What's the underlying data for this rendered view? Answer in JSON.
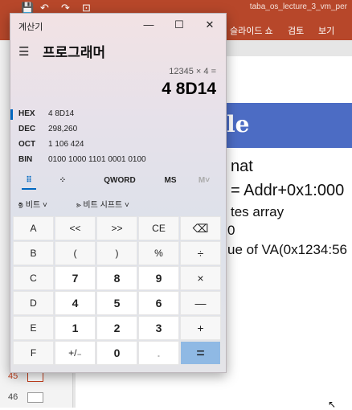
{
  "ppt": {
    "title": "taba_os_lecture_3_vm_per",
    "quick_access": [
      "💾",
      "↶",
      "↷",
      "⊡"
    ],
    "ribbon_tabs": [
      "슬라이드 쇼",
      "검토",
      "보기"
    ],
    "slides": [
      {
        "num": "45"
      },
      {
        "num": "46"
      }
    ],
    "slide": {
      "title_fragment": "le",
      "lines": [
        "nat",
        "= Addr+0x1:000",
        "tes array",
        "0",
        "ue of VA(0x1234:56"
      ]
    }
  },
  "calculator": {
    "window_title": "계산기",
    "window_buttons": [
      "—",
      "☐",
      "✕"
    ],
    "mode": "프로그래머",
    "expression": "12345 × 4 =",
    "result": "4 8D14",
    "radix": [
      {
        "name": "HEX",
        "value": "4 8D14",
        "active": true
      },
      {
        "name": "DEC",
        "value": "298,260",
        "active": false
      },
      {
        "name": "OCT",
        "value": "1 106 424",
        "active": false
      },
      {
        "name": "BIN",
        "value": "0100 1000 1101 0001 0100",
        "active": false
      }
    ],
    "tabs": {
      "keypad_icon": "⠿",
      "bit_icon": "⁘",
      "word_size": "QWORD",
      "memory_store": "MS",
      "memory_recall": "M˅"
    },
    "bitops": {
      "bitwise": "비트",
      "bitshift": "비트 시프트"
    },
    "keys": [
      [
        "A",
        "<<",
        ">>",
        "CE",
        "⌫"
      ],
      [
        "B",
        "(",
        ")",
        "%",
        "÷"
      ],
      [
        "C",
        "7",
        "8",
        "9",
        "×"
      ],
      [
        "D",
        "4",
        "5",
        "6",
        "—"
      ],
      [
        "E",
        "1",
        "2",
        "3",
        "+"
      ],
      [
        "F",
        "+/₋",
        "0",
        ".",
        "="
      ]
    ]
  }
}
